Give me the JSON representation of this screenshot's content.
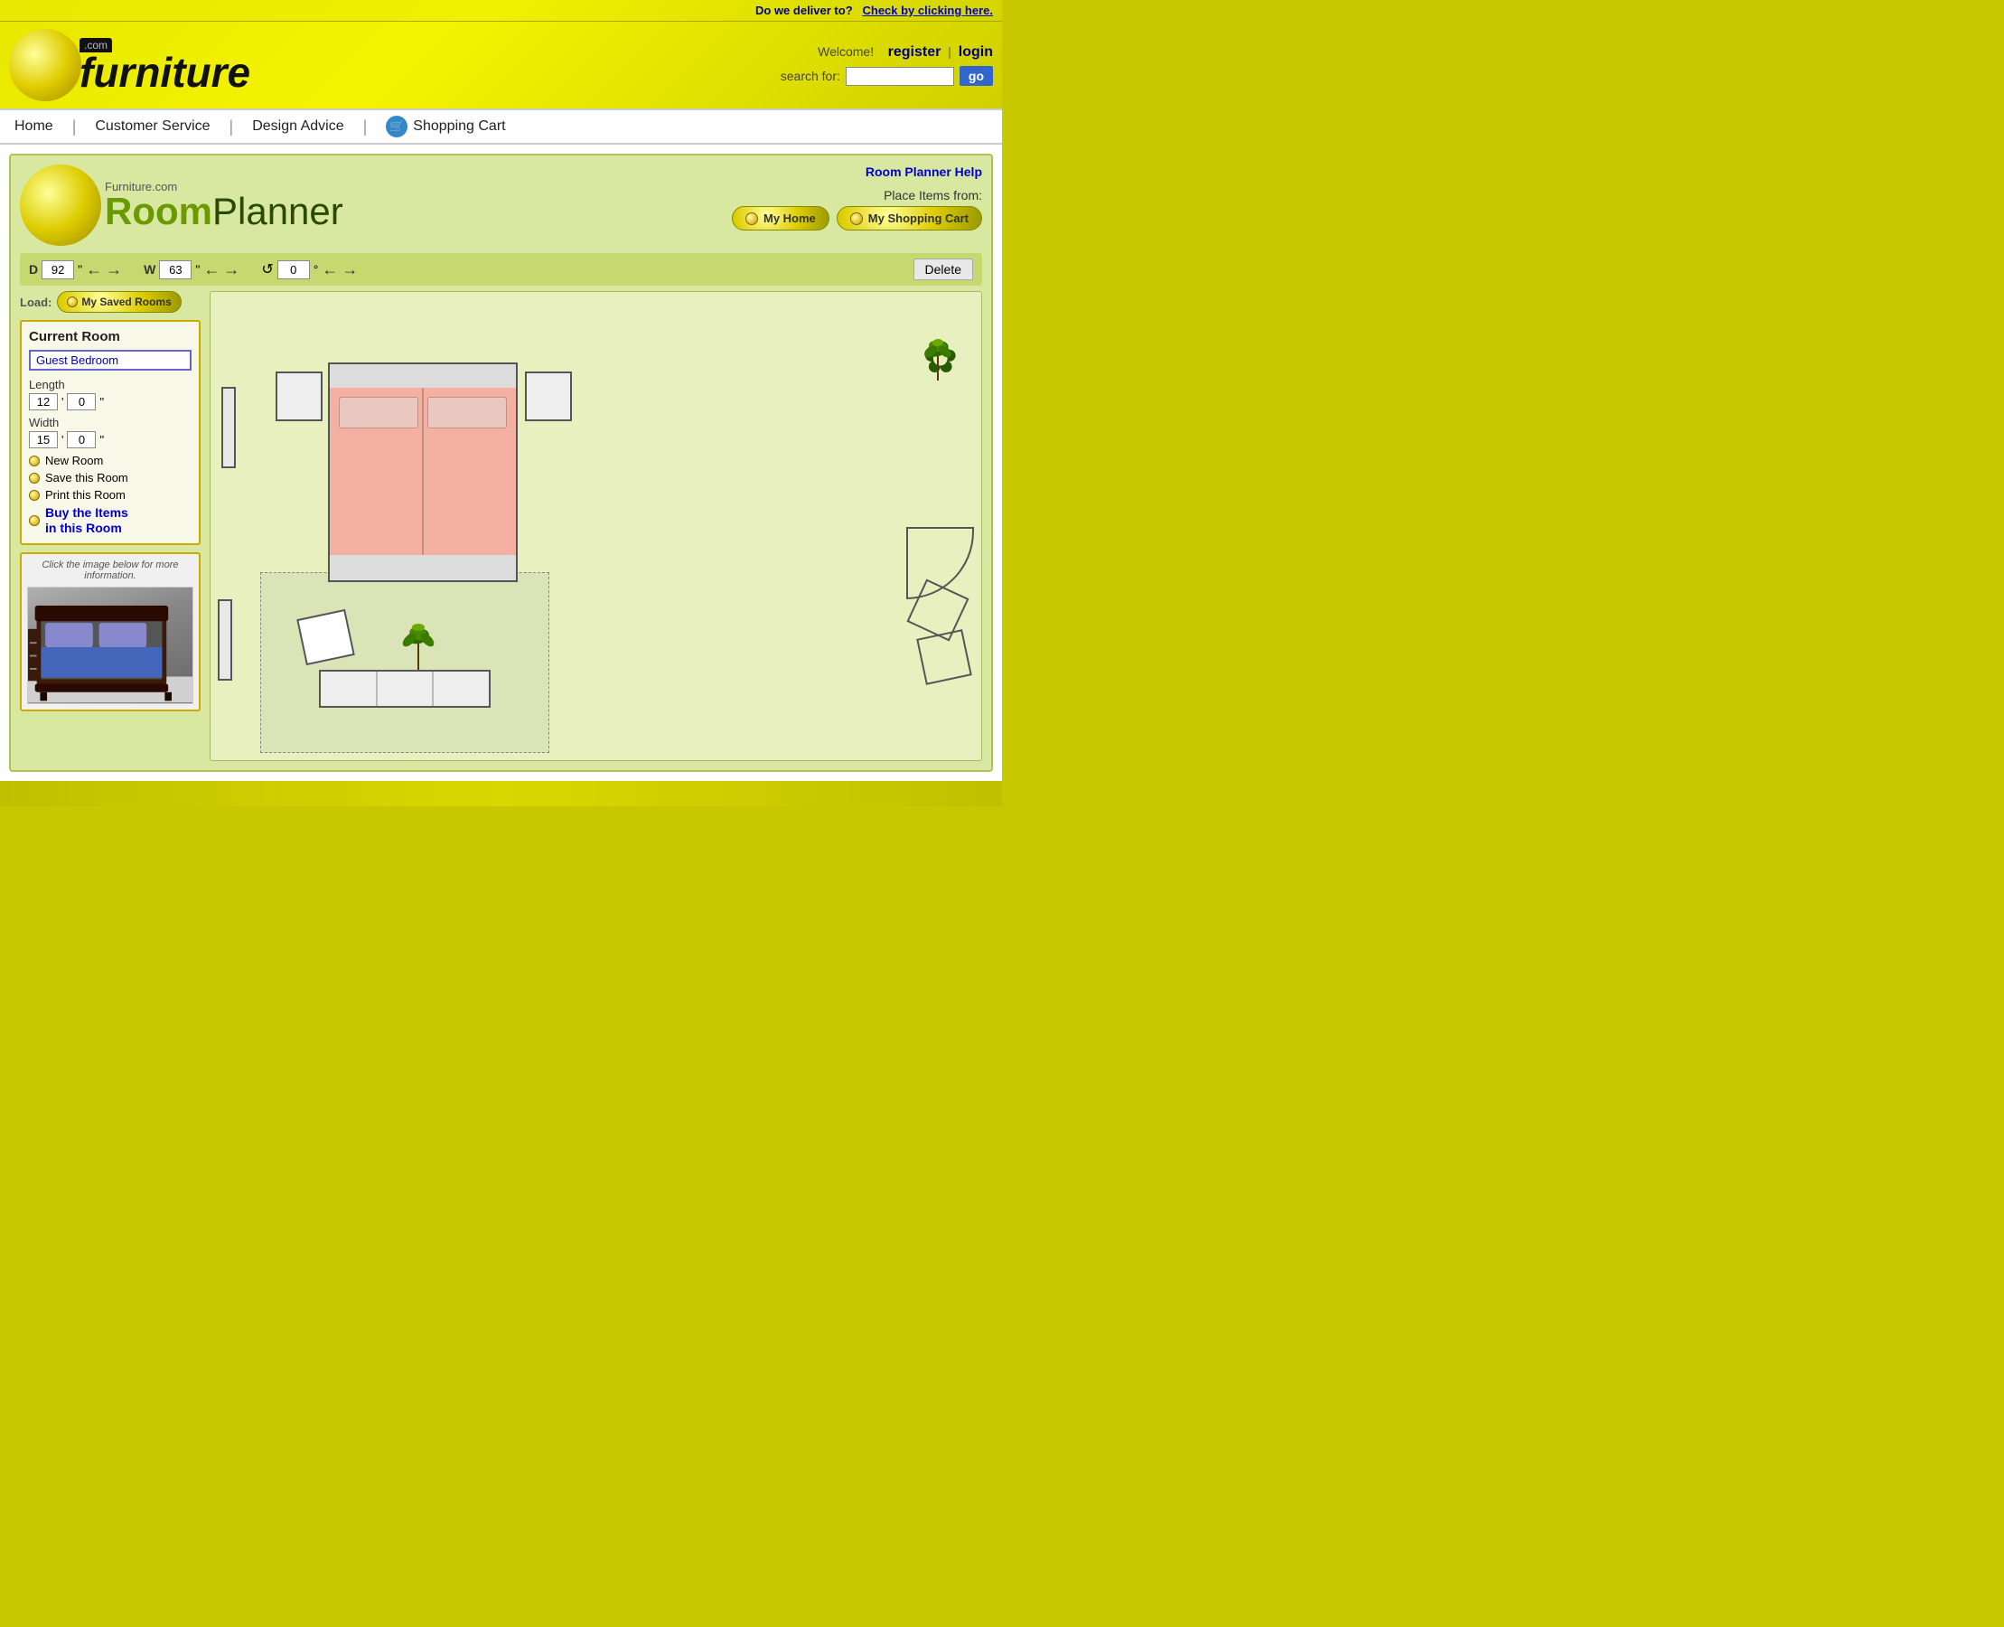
{
  "delivery_bar": {
    "label": "Do we deliver to?",
    "link_text": "Check by clicking here."
  },
  "header": {
    "logo_com": ".com",
    "logo_name": "furniture",
    "welcome_text": "Welcome!",
    "register_label": "register",
    "pipe": "|",
    "login_label": "login",
    "search_label": "search for:",
    "search_placeholder": "",
    "go_label": "go"
  },
  "nav": {
    "home": "Home",
    "customer_service": "Customer Service",
    "design_advice": "Design Advice",
    "shopping_cart": "Shopping Cart"
  },
  "room_planner": {
    "help_link": "Room Planner Help",
    "logo_site": "Furniture.com",
    "logo_room": "Room",
    "logo_planner": "Planner",
    "place_items_label": "Place Items from:",
    "my_home_btn": "My Home",
    "my_shopping_cart_btn": "My Shopping Cart",
    "controls": {
      "d_label": "D",
      "d_value": "92",
      "d_unit": "\"",
      "w_label": "W",
      "w_value": "63",
      "w_unit": "\"",
      "rotate_value": "0",
      "rotate_unit": "°",
      "delete_label": "Delete"
    },
    "load_label": "Load:",
    "saved_rooms_btn": "My Saved Rooms",
    "current_room": {
      "title": "Current Room",
      "name_value": "Guest Bedroom",
      "length_label": "Length",
      "length_ft": "12",
      "length_in": "0",
      "length_unit": "\"",
      "width_label": "Width",
      "width_ft": "15",
      "width_in": "0",
      "width_unit": "\""
    },
    "actions": {
      "new_room": "New Room",
      "save_room": "Save this Room",
      "print_room": "Print this Room",
      "buy_items_line1": "Buy the Items",
      "buy_items_line2": "in this Room"
    },
    "preview": {
      "hint": "Click the image below for more information."
    }
  }
}
